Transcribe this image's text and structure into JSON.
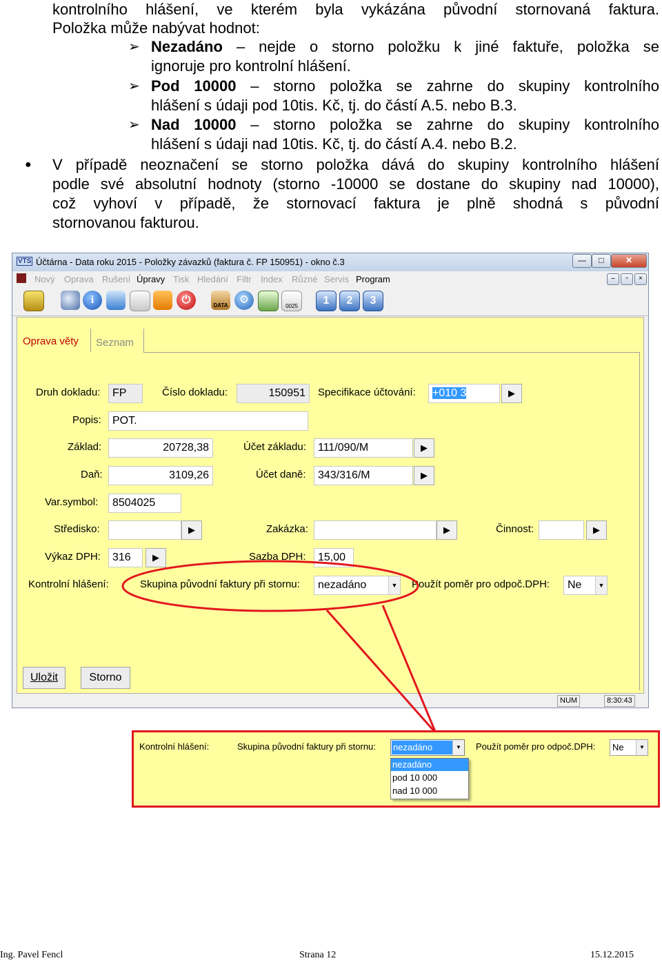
{
  "doc": {
    "line1": "kontrolního hlášení, ve kterém byla vykázána původní stornovaná faktura.",
    "line2": "Položka může nabývat hodnot:",
    "opt1_bold": "Nezadáno",
    "opt1_rest": "– nejde o storno položku k jiné faktuře, položka se",
    "opt1_line2": "ignoruje pro kontrolní hlášení.",
    "opt2_bold": "Pod 10000",
    "opt2_rest": "– storno položka se zahrne do skupiny kontrolního",
    "opt2_line2": "hlášení s údaji pod 10tis. Kč, tj. do částí A.5. nebo B.3.",
    "opt3_bold": "Nad 10000",
    "opt3_rest": "– storno položka se zahrne do skupiny kontrolního",
    "opt3_line2": "hlášení s údaji nad 10tis. Kč, tj. do částí A.4. nebo B.2.",
    "bullet_line1": "V případě neoznačení se storno položka dává do skupiny kontrolního hlášení",
    "bullet_line2": "podle své absolutní hodnoty (storno -10000 se dostane do skupiny nad 10000),",
    "bullet_line3": "což vyhoví v případě, že stornovací faktura je plně shodná s původní",
    "bullet_line4": "stornovanou fakturou."
  },
  "window": {
    "title": "Účtárna - Data roku 2015 - Položky závazků (faktura č. FP      150951) - okno č.3",
    "logo": "VTS",
    "menu": [
      "Nový",
      "Oprava",
      "Rušení",
      "Úpravy",
      "Tisk",
      "Hledání",
      "Filtr",
      "Index",
      "Různé",
      "Servis",
      "Program"
    ],
    "toolbar_data_label": "DATA",
    "toolbar_count_label": "0025",
    "toolbar_numbers": [
      "1",
      "2",
      "3"
    ],
    "tabs": [
      "Oprava věty",
      "Seznam"
    ],
    "colors": {
      "client_bg": "#ffffa0",
      "tab_active": "#c00000",
      "highlight": "#e2171e",
      "selection": "#3399ff"
    }
  },
  "form": {
    "druh_label": "Druh dokladu:",
    "druh_value": "FP",
    "cislo_label": "Číslo dokladu:",
    "cislo_value": "150951",
    "spec_label": "Specifikace účtování:",
    "spec_value": "+010 3",
    "popis_label": "Popis:",
    "popis_value": "POT.",
    "zaklad_label": "Základ:",
    "zaklad_value": "20728,38",
    "ucet_zakladu_label": "Účet základu:",
    "ucet_zakladu_value": "111/090/M",
    "dan_label": "Daň:",
    "dan_value": "3109,26",
    "ucet_dane_label": "Účet daně:",
    "ucet_dane_value": "343/316/M",
    "varsym_label": "Var.symbol:",
    "varsym_value": "8504025",
    "stredisko_label": "Středisko:",
    "stredisko_value": "",
    "zakazka_label": "Zakázka:",
    "zakazka_value": "",
    "cinnost_label": "Činnost:",
    "cinnost_value": "",
    "vykaz_label": "Výkaz DPH:",
    "vykaz_value": "316",
    "sazba_label": "Sazba DPH:",
    "sazba_value": "15,00",
    "kontrolni_label": "Kontrolní hlášení:",
    "skupina_label": "Skupina původní faktury při stornu:",
    "skupina_value": "nezadáno",
    "pomer_label": "Použít poměr pro odpoč.DPH:",
    "pomer_value": "Ne",
    "save_button": "Uložit",
    "storno_button": "Storno"
  },
  "status": {
    "num": "NUM",
    "time": "8:30:43"
  },
  "zoom": {
    "kontrolni_label": "Kontrolní hlášení:",
    "skupina_label": "Skupina původní faktury při stornu:",
    "skupina_value": "nezadáno",
    "pomer_label": "Použít poměr pro odpoč.DPH:",
    "pomer_value": "Ne",
    "options": [
      "nezadáno",
      "pod 10 000",
      "nad 10 000"
    ]
  },
  "footer": {
    "author": "Ing. Pavel Fencl",
    "page": "Strana 12",
    "date": "15.12.2015"
  }
}
